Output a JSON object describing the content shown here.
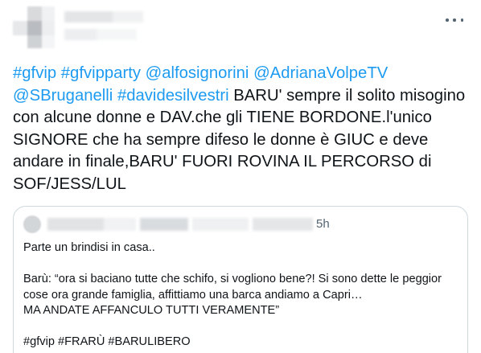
{
  "tweet": {
    "more_icon": "more-horizontal-icon",
    "segments": [
      {
        "text": "#gfvip",
        "link": true
      },
      {
        "text": " ",
        "link": false
      },
      {
        "text": "#gfvipparty",
        "link": true
      },
      {
        "text": " ",
        "link": false
      },
      {
        "text": "@alfosignorini",
        "link": true
      },
      {
        "text": " ",
        "link": false
      },
      {
        "text": "@AdrianaVolpeTV",
        "link": true
      },
      {
        "text": " ",
        "link": false
      },
      {
        "text": "@SBruganelli",
        "link": true
      },
      {
        "text": " ",
        "link": false
      },
      {
        "text": "#davidesilvestri",
        "link": true
      },
      {
        "text": " BARU' sempre il solito misogino con alcune donne e DAV.che gli TIENE BORDONE.l'unico SIGNORE che ha sempre difeso le donne è GIUC e deve andare in finale,BARU' FUORI ROVINA IL PERCORSO di SOF/JESS/LUL",
        "link": false
      }
    ],
    "link_color": "#1d9bf0"
  },
  "quote": {
    "time": "5h",
    "body": "Parte un brindisi in casa..\n\nBarù: “ora si baciano tutte che schifo, si vogliono bene?! Si sono dette le peggior cose ora grande famiglia, affittiamo una barca andiamo a Capri…\nMA ANDATE AFFANCULO TUTTI VERAMENTE”\n\n#gfvip #FRARÙ #BARULIBERO"
  }
}
